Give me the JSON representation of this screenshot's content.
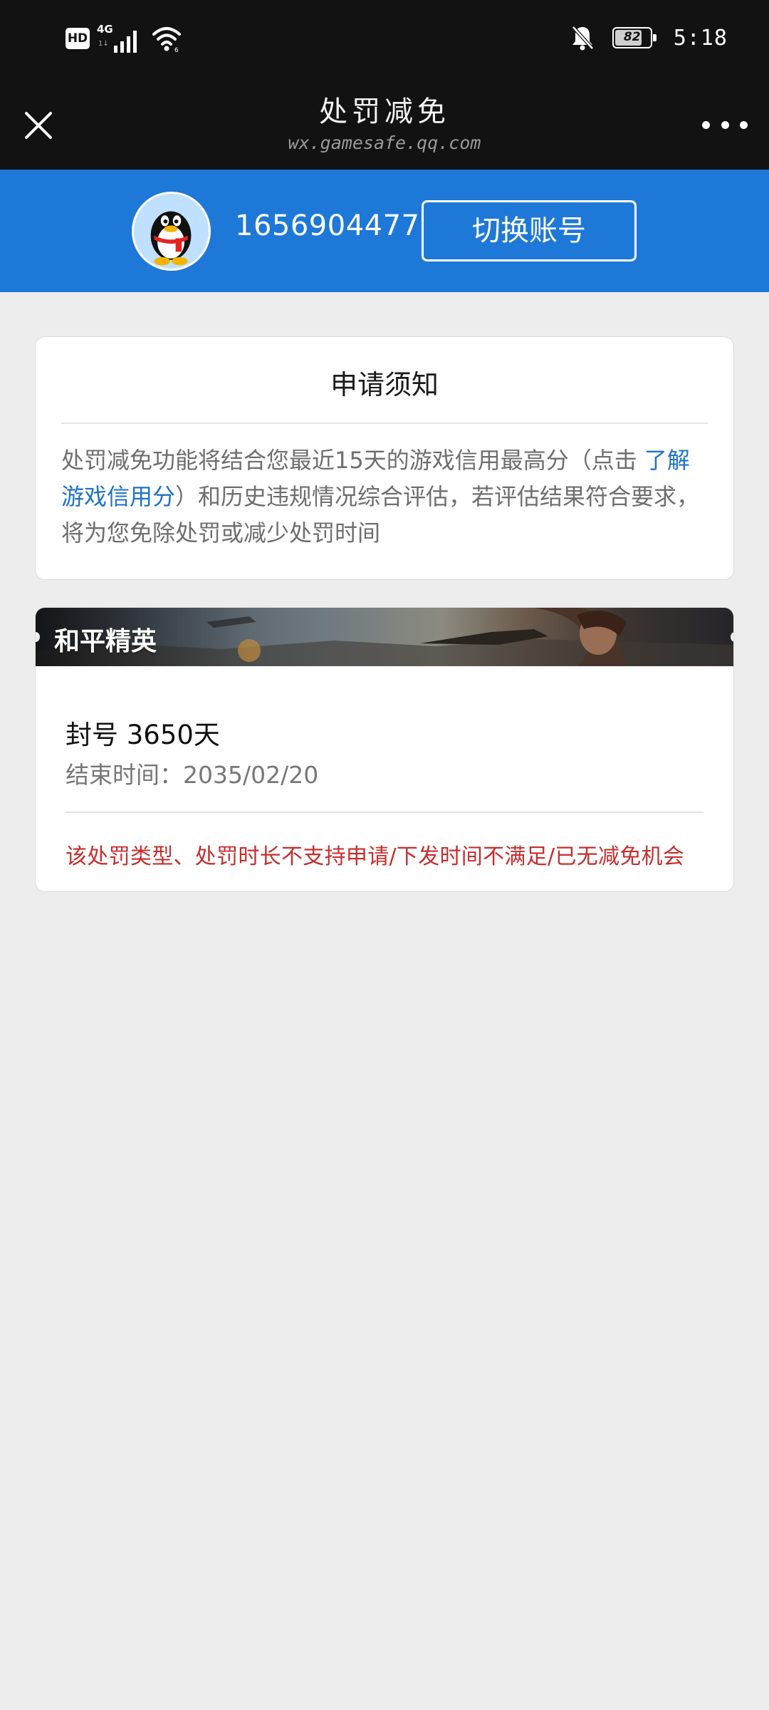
{
  "status_bar": {
    "hd_label": "HD",
    "network_type": "4G",
    "network_sub": "1↓",
    "battery_level": 82,
    "battery_text": "82",
    "time": "5:18",
    "icons": [
      "signal-icon",
      "wifi-icon",
      "bell-muted-icon",
      "battery-icon"
    ]
  },
  "title_bar": {
    "title": "处罚减免",
    "url": "wx.gamesafe.qq.com",
    "close_icon": "close-icon",
    "more_icon": "more-icon"
  },
  "account": {
    "qq_number": "1656904477",
    "switch_label": "切换账号",
    "avatar_icon": "qq-penguin-icon"
  },
  "notice": {
    "title": "申请须知",
    "body_before": "处罚减免功能将结合您最近15天的游戏信用最高分（点击 ",
    "link_text": "了解游戏信用分",
    "body_after": "）和历史违规情况综合评估，若评估结果符合要求，将为您免除处罚或减少处罚时间"
  },
  "game": {
    "name": "和平精英",
    "penalty": "封号 3650天",
    "end_time": "结束时间：2035/02/20",
    "ineligible_note": "该处罚类型、处罚时长不支持申请/下发时间不满足/已无减免机会"
  },
  "colors": {
    "top_bar": "#121212",
    "brand_blue": "#1e78d7",
    "link_blue": "#1e72c8",
    "warning_red": "#c62d2d",
    "page_bg": "#ededed"
  }
}
